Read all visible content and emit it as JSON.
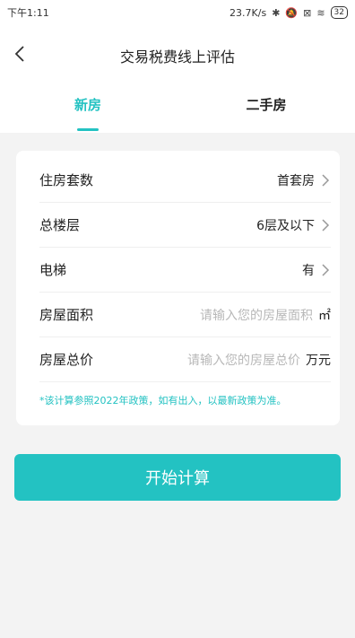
{
  "status": {
    "time": "下午1:11",
    "network_speed": "23.7K/s",
    "battery": "32"
  },
  "header": {
    "title": "交易税费线上评估",
    "back_icon": "chevron-left-icon"
  },
  "tabs": [
    {
      "label": "新房",
      "active": true
    },
    {
      "label": "二手房",
      "active": false
    }
  ],
  "form": {
    "rows": [
      {
        "label": "住房套数",
        "value": "首套房"
      },
      {
        "label": "总楼层",
        "value": "6层及以下"
      },
      {
        "label": "电梯",
        "value": "有"
      },
      {
        "label": "房屋面积",
        "placeholder": "请输入您的房屋面积",
        "unit": "㎡"
      },
      {
        "label": "房屋总价",
        "placeholder": "请输入您的房屋总价",
        "unit": "万元"
      }
    ],
    "note": "*该计算参照2022年政策，如有出入，以最新政策为准。"
  },
  "actions": {
    "calculate_label": "开始计算"
  },
  "colors": {
    "accent": "#23c2c2",
    "background": "#f3f3f3"
  }
}
